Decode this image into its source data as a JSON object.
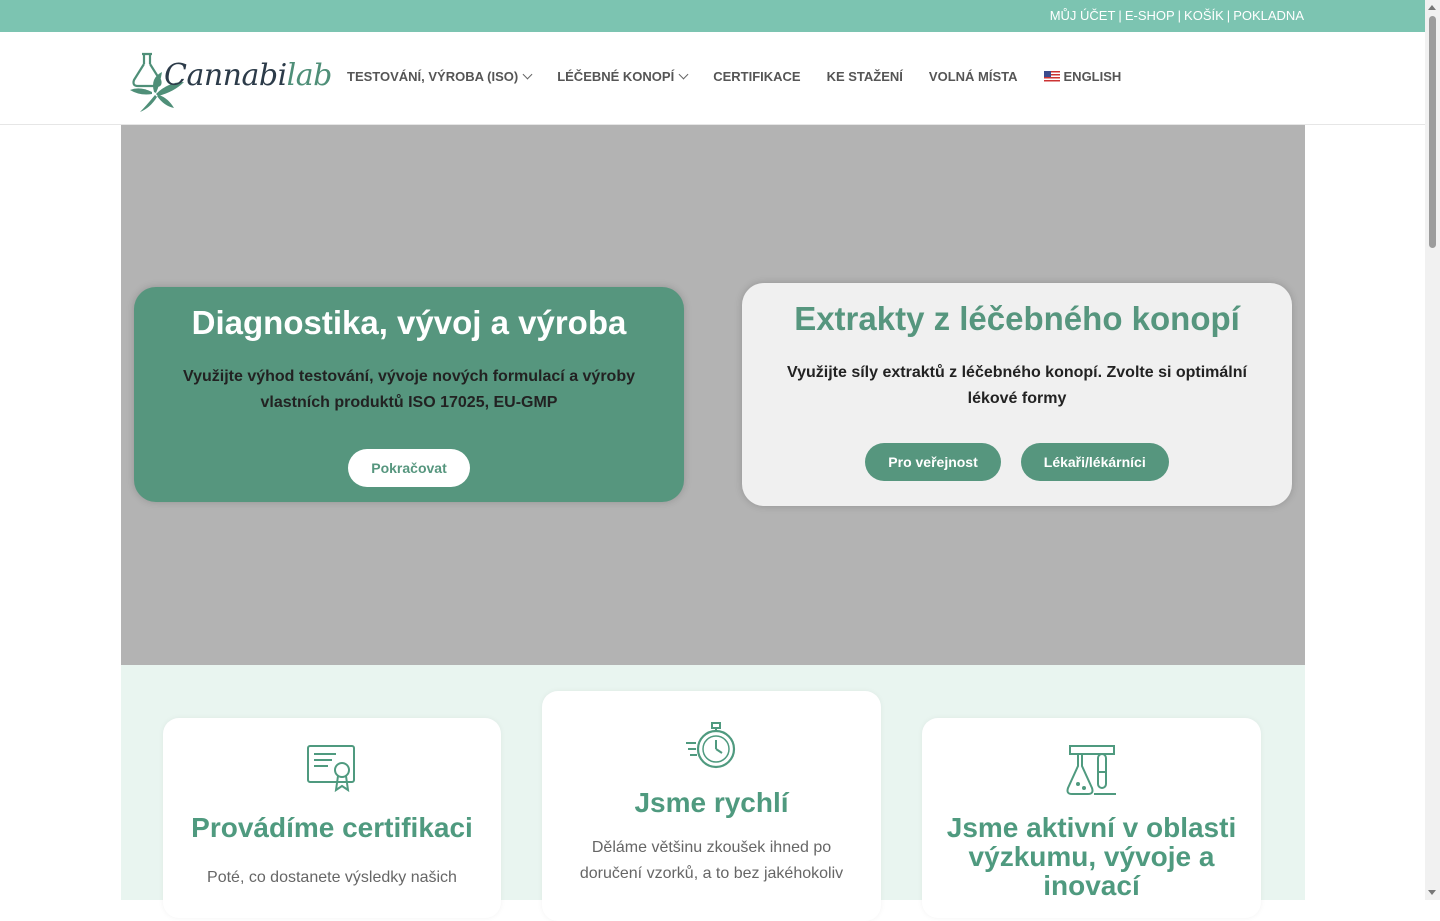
{
  "topbar": {
    "links": [
      "MŮJ ÚČET",
      "E-SHOP",
      "KOŠÍK",
      "POKLADNA"
    ],
    "separator": "|"
  },
  "logo": {
    "part1": "Cannabi",
    "part2": "lab"
  },
  "nav": {
    "items": [
      {
        "label": "TESTOVÁNÍ, VÝROBA (ISO)",
        "dropdown": true
      },
      {
        "label": "LÉČEBNÉ KONOPÍ",
        "dropdown": true
      },
      {
        "label": "CERTIFIKACE",
        "dropdown": false
      },
      {
        "label": "KE STAŽENÍ",
        "dropdown": false
      },
      {
        "label": "VOLNÁ MÍSTA",
        "dropdown": false
      },
      {
        "label": "ENGLISH",
        "dropdown": false,
        "icon": "us-flag-icon"
      }
    ]
  },
  "hero": {
    "card_left": {
      "title": "Diagnostika, vývoj a výroba",
      "text": "Využijte výhod testování, vývoje nových formulací a výroby vlastních produktů ISO 17025, EU-GMP",
      "button": "Pokračovat"
    },
    "card_right": {
      "title": "Extrakty z léčebného konopí",
      "text": "Využijte síly extraktů z léčebného konopí. Zvolte si optimální lékové formy",
      "button_public": "Pro veřejnost",
      "button_doctors": "Lékaři/lékárníci"
    }
  },
  "features": [
    {
      "icon": "certificate-icon",
      "title": "Provádíme certifikaci",
      "text": "Poté, co dostanete výsledky našich"
    },
    {
      "icon": "stopwatch-icon",
      "title": "Jsme rychlí",
      "text": "Děláme většinu zkoušek ihned po doručení vzorků, a to bez jakéhokoliv"
    },
    {
      "icon": "lab-flask-icon",
      "title": "Jsme aktivní v oblasti výzkumu, vývoje a inovací",
      "text": ""
    }
  ],
  "colors": {
    "topbar": "#7cc4b1",
    "brand_green": "#56967e",
    "hero_bg": "#b3b3b3",
    "section_bg": "#e9f5f0"
  }
}
